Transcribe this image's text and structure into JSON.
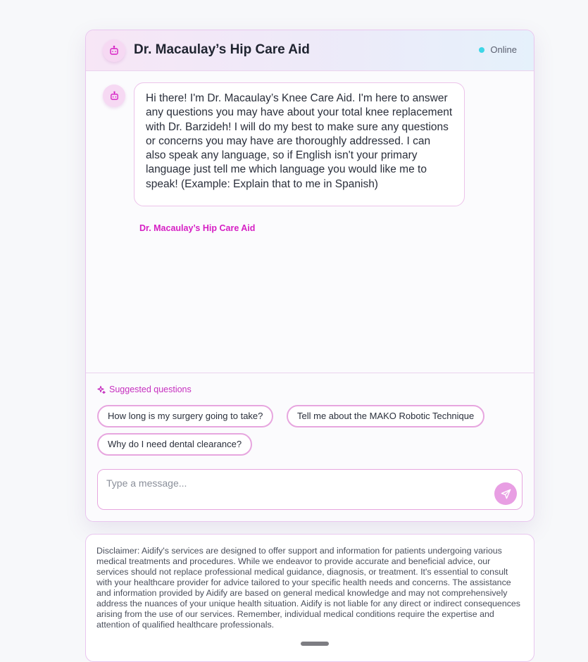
{
  "header": {
    "title": "Dr. Macaulay’s Hip Care Aid",
    "status": "Online",
    "avatar_icon": "bot-icon"
  },
  "conversation": {
    "messages": [
      {
        "text": "Hi there! I'm Dr. Macaulay’s Knee Care Aid. I'm here to answer any questions you may have about your total knee replacement with Dr. Barzideh! I will do my best to make sure any questions or concerns you may have are thoroughly addressed. I can also speak any language, so if English isn't your primary language just tell me which language you would like me to speak! (Example: Explain that to me in Spanish)",
        "sender": "Dr. Macaulay’s Hip Care Aid",
        "avatar_icon": "bot-icon"
      }
    ]
  },
  "suggestions": {
    "label": "Suggested questions",
    "icon": "sparkle-icon",
    "items": [
      "How long is my surgery going to take?",
      "Tell me about the MAKO Robotic Technique",
      "Why do I need dental clearance?"
    ]
  },
  "composer": {
    "placeholder": "Type a message...",
    "value": "",
    "send_icon": "send-icon"
  },
  "disclaimer": {
    "text": "Disclaimer: Aidify's services are designed to offer support and information for patients undergoing various medical treatments and procedures. While we endeavor to provide accurate and beneficial advice, our services should not replace professional medical guidance, diagnosis, or treatment. It's essential to consult with your healthcare provider for advice tailored to your specific health needs and concerns. The assistance and information provided by Aidify are based on general medical knowledge and may not comprehensively address the nuances of your unique health situation. Aidify is not liable for any direct or indirect consequences arising from the use of our services. Remember, individual medical conditions require the expertise and attention of qualified healthcare professionals."
  },
  "colors": {
    "accent": "#d61fc4",
    "chip_border": "#e7a6df",
    "online": "#3dd6e6",
    "send_button": "#e89ee3"
  }
}
